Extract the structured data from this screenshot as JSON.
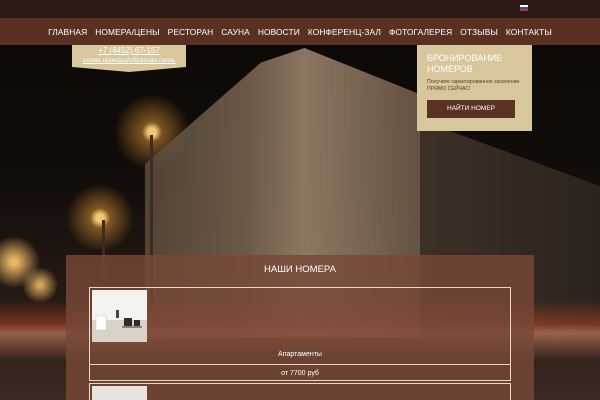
{
  "nav": {
    "items": [
      "ГЛАВНАЯ",
      "НОМЕРА/ЦЕНЫ",
      "РЕСТОРАН",
      "САУНА",
      "НОВОСТИ",
      "КОНФЕРЕНЦ-ЗАЛ",
      "ФОТОГАЛЕРЕЯ",
      "ОТЗЫВЫ",
      "КОНТАКТЫ"
    ],
    "accent": "#62342a"
  },
  "language": {
    "flag_icon": "russian-flag-icon"
  },
  "contact": {
    "phone": "+7 (8452) 67-157",
    "scheme": "схема проезда/обратная связь"
  },
  "booking": {
    "title": "БРОНИРОВАНИЕ НОМЕРОВ",
    "subtitle": "Получите гарантированное заселение ПРЯМО СЕЙЧАС!",
    "button": "НАЙТИ НОМЕР",
    "panel_color": "#d8c79c",
    "button_color": "#5a3224"
  },
  "rooms": {
    "title": "НАШИ НОМЕРА",
    "items": [
      {
        "name": "Апартаменты",
        "price": "от 7700 руб"
      }
    ]
  }
}
